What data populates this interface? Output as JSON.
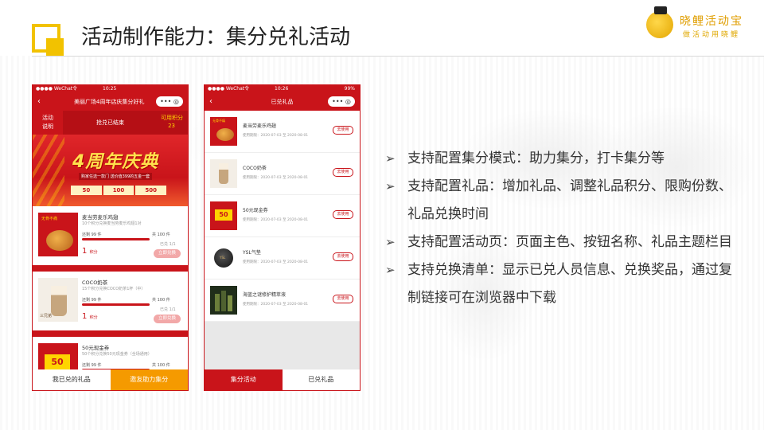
{
  "header": {
    "title": "活动制作能力：集分兑礼活动",
    "brand_name": "晓鲤活动宝",
    "brand_slogan": "做活动用晓鲤"
  },
  "phone1": {
    "status_carrier": "●●●● WeChat令",
    "status_time": "10:25",
    "nav_title": "美丽广场4周年店庆集分好礼",
    "capsule": "•••  ◎",
    "rules_label_1": "活动",
    "rules_label_2": "说明",
    "status_text": "抢兑已结束",
    "points_label": "可用积分",
    "points_value": "23",
    "banner_title": "4周年庆典",
    "banner_sub": "购家任选一款门 送价值399的五金一套",
    "banner_coupons": [
      "50",
      "100",
      "500"
    ],
    "gifts": [
      {
        "thumb_label": "无骨不痛",
        "name": "麦当劳麦乐鸡翅",
        "desc": "10个积分兑换麦当劳麦乐鸡翅1对",
        "left": "还剩 99 件",
        "total": "共 100 件",
        "sold": "已兑 1/1",
        "points": "1",
        "points_unit": "积分",
        "button": "立即兑换"
      },
      {
        "thumb_label": "三兄弟",
        "name": "COCO奶茶",
        "desc": "15个积分兑换COCO奶茶1杯（中）",
        "left": "还剩 99 件",
        "total": "共 100 件",
        "sold": "已兑 1/1",
        "points": "1",
        "points_unit": "积分",
        "button": "立即兑换"
      },
      {
        "thumb_label": "50",
        "name": "50元现金券",
        "desc": "50个积分兑换50元现金券（全场通用）",
        "left": "还剩 99 件",
        "total": "共 100 件",
        "sold": "",
        "points": "",
        "points_unit": "",
        "button": ""
      }
    ],
    "tab_left": "我已兑的礼品",
    "tab_right": "邀友助力集分"
  },
  "phone2": {
    "status_carrier": "●●●● WeChat令",
    "status_time": "10:26",
    "status_battery": "99%",
    "nav_title": "已兑礼品",
    "capsule": "•••  ◎",
    "items": [
      {
        "name": "麦当劳麦乐鸡翅",
        "date": "使用期限：2020-07-03 至 2020-08-01",
        "button": "去使用",
        "thumb_label": "无骨不痛"
      },
      {
        "name": "COCO奶茶",
        "date": "使用期限：2020-07-03 至 2020-08-01",
        "button": "去使用"
      },
      {
        "name": "50元现金券",
        "date": "使用期限：2020-07-03 至 2020-08-01",
        "button": "去使用",
        "thumb_label": "50"
      },
      {
        "name": "YSL气垫",
        "date": "使用期限：2020-07-03 至 2020-08-01",
        "button": "去使用",
        "thumb_label": "YSL"
      },
      {
        "name": "海蓝之谜修护精萃液",
        "date": "使用期限：2020-07-03 至 2020-08-01",
        "button": "去使用"
      }
    ],
    "tab_left": "集分活动",
    "tab_right": "已兑礼品"
  },
  "bullets": [
    "支持配置集分模式：助力集分，打卡集分等",
    "支持配置礼品：增加礼品、调整礼品积分、限购份数、礼品兑换时间",
    "支持配置活动页：页面主色、按钮名称、礼品主题栏目",
    "支持兑换清单：显示已兑人员信息、兑换奖品，通过复制链接可在浏览器中下载"
  ],
  "bullet_icon": "arrow-right-icon",
  "colors": {
    "accent": "#c9141a",
    "logo_yellow": "#f2c200",
    "tab_orange": "#f59a00"
  }
}
